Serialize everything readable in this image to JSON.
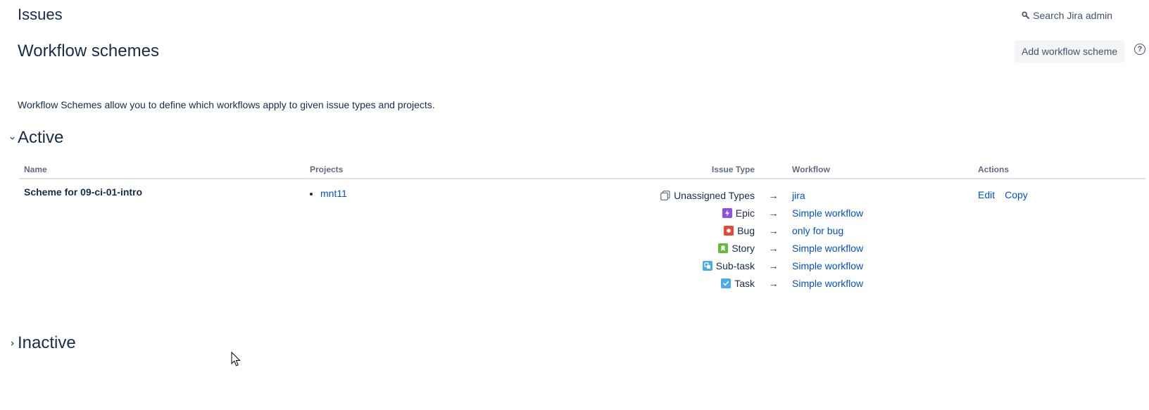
{
  "header": {
    "section_title": "Issues",
    "search_label": "Search Jira admin"
  },
  "page": {
    "title": "Workflow schemes",
    "add_button_label": "Add workflow scheme",
    "help_symbol": "?",
    "intro_text": "Workflow Schemes allow you to define which workflows apply to given issue types and projects."
  },
  "sections": {
    "active_label": "Active",
    "inactive_label": "Inactive"
  },
  "table": {
    "columns": {
      "name": "Name",
      "projects": "Projects",
      "issue_type": "Issue Type",
      "workflow": "Workflow",
      "actions": "Actions"
    },
    "rows": [
      {
        "name": "Scheme for 09-ci-01-intro",
        "projects": [
          "mnt11"
        ],
        "mappings": [
          {
            "issue_type": "Unassigned Types",
            "icon": "unassigned-icon",
            "arrow": "→",
            "workflow": "jira"
          },
          {
            "issue_type": "Epic",
            "icon": "epic-icon",
            "color": "#904ee2",
            "arrow": "→",
            "workflow": "Simple workflow"
          },
          {
            "issue_type": "Bug",
            "icon": "bug-icon",
            "color": "#e5493a",
            "arrow": "→",
            "workflow": "only for bug"
          },
          {
            "issue_type": "Story",
            "icon": "story-icon",
            "color": "#63ba3c",
            "arrow": "→",
            "workflow": "Simple workflow"
          },
          {
            "issue_type": "Sub-task",
            "icon": "subtask-icon",
            "color": "#4bade8",
            "arrow": "→",
            "workflow": "Simple workflow"
          },
          {
            "issue_type": "Task",
            "icon": "task-icon",
            "color": "#4bade8",
            "arrow": "→",
            "workflow": "Simple workflow"
          }
        ],
        "actions": {
          "edit": "Edit",
          "copy": "Copy"
        }
      }
    ]
  },
  "colors": {
    "link": "#0052cc",
    "heading": "#172b4d",
    "muted": "#5e6c84",
    "button_bg": "#f4f5f7"
  }
}
